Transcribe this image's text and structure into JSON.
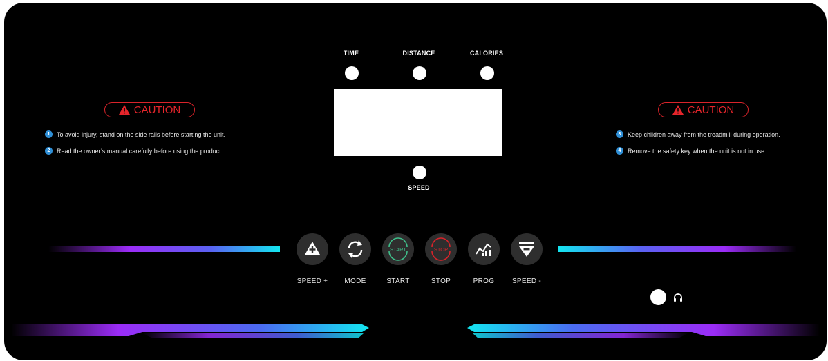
{
  "indicators": {
    "time": "TIME",
    "distance": "DISTANCE",
    "calories": "CALORIES",
    "speed": "SPEED"
  },
  "caution": {
    "label": "CAUTION",
    "color": "#e5252b"
  },
  "notes_left": [
    {
      "num": "1",
      "text": "To avoid injury, stand on the side rails before starting the unit."
    },
    {
      "num": "2",
      "text": "Read the owner’s manual carefully before using the product."
    }
  ],
  "notes_right": [
    {
      "num": "3",
      "text": "Keep children away from the treadmill during operation."
    },
    {
      "num": "4",
      "text": "Remove the safety key when the unit is not in use."
    }
  ],
  "buttons": {
    "speed_up": "SPEED +",
    "mode": "MODE",
    "start": "START",
    "start_icon_text": "START",
    "stop": "STOP",
    "stop_icon_text": "STOP",
    "prog": "PROG",
    "speed_down": "SPEED -"
  },
  "icons": {
    "speed_up": "plus-triangle-icon",
    "mode": "cycle-arrows-icon",
    "start": "start-circle-icon",
    "stop": "stop-circle-icon",
    "prog": "program-graph-icon",
    "speed_down": "minus-triangle-icon",
    "headphone": "headphone-icon"
  },
  "colors": {
    "cyan": "#13e6f0",
    "purple": "#9b2cf7",
    "start_green": "#3fbf8a",
    "stop_red": "#d9232a"
  }
}
